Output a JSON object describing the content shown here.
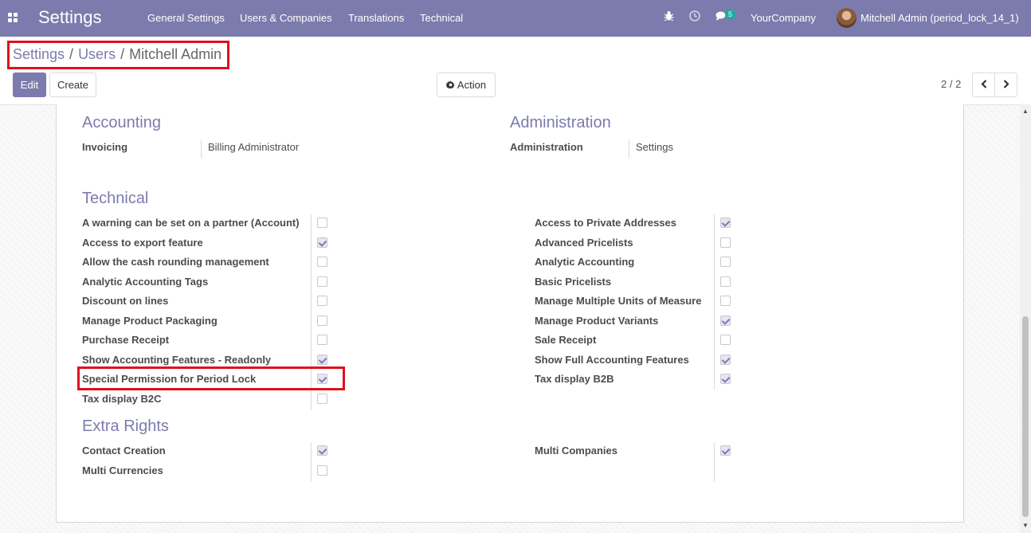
{
  "navbar": {
    "brand": "Settings",
    "menu": [
      "General Settings",
      "Users & Companies",
      "Translations",
      "Technical"
    ],
    "icons": [
      "bug-icon",
      "clock-icon",
      "chat-icon"
    ],
    "message_count": "5",
    "company": "YourCompany",
    "user": "Mitchell Admin (period_lock_14_1)"
  },
  "breadcrumb": {
    "items": [
      "Settings",
      "Users"
    ],
    "current": "Mitchell Admin",
    "separator": "/"
  },
  "buttons": {
    "edit": "Edit",
    "create": "Create",
    "action": "Action"
  },
  "pager": {
    "value": "2 / 2"
  },
  "sections": {
    "accounting": {
      "title": "Accounting",
      "field_label": "Invoicing",
      "field_value": "Billing Administrator"
    },
    "administration": {
      "title": "Administration",
      "field_label": "Administration",
      "field_value": "Settings"
    },
    "technical": {
      "title": "Technical",
      "left": [
        {
          "label": "A warning can be set on a partner (Account)",
          "checked": false
        },
        {
          "label": "Access to export feature",
          "checked": true
        },
        {
          "label": "Allow the cash rounding management",
          "checked": false
        },
        {
          "label": "Analytic Accounting Tags",
          "checked": false
        },
        {
          "label": "Discount on lines",
          "checked": false
        },
        {
          "label": "Manage Product Packaging",
          "checked": false
        },
        {
          "label": "Purchase Receipt",
          "checked": false
        },
        {
          "label": "Show Accounting Features - Readonly",
          "checked": true
        },
        {
          "label": "Special Permission for Period Lock",
          "checked": true
        },
        {
          "label": "Tax display B2C",
          "checked": false
        }
      ],
      "right": [
        {
          "label": "Access to Private Addresses",
          "checked": true
        },
        {
          "label": "Advanced Pricelists",
          "checked": false
        },
        {
          "label": "Analytic Accounting",
          "checked": false
        },
        {
          "label": "Basic Pricelists",
          "checked": false
        },
        {
          "label": "Manage Multiple Units of Measure",
          "checked": false
        },
        {
          "label": "Manage Product Variants",
          "checked": true
        },
        {
          "label": "Sale Receipt",
          "checked": false
        },
        {
          "label": "Show Full Accounting Features",
          "checked": true
        },
        {
          "label": "Tax display B2B",
          "checked": true
        }
      ]
    },
    "extra_rights": {
      "title": "Extra Rights",
      "left": [
        {
          "label": "Contact Creation",
          "checked": true
        },
        {
          "label": "Multi Currencies",
          "checked": false
        }
      ],
      "right": [
        {
          "label": "Multi Companies",
          "checked": true
        }
      ]
    }
  },
  "colors": {
    "brand": "#7c7bad",
    "highlight": "#e0101e",
    "badge": "#1faa9b"
  }
}
